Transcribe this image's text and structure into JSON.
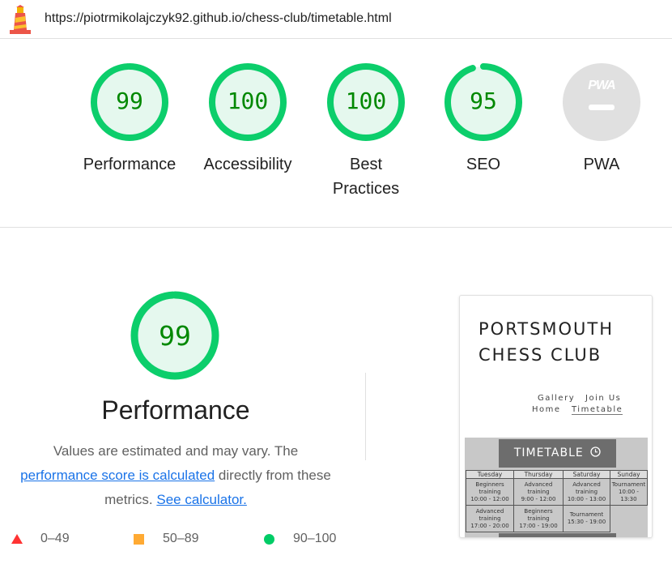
{
  "url": "https://piotrmikolajczyk92.github.io/chess-club/timetable.html",
  "colors": {
    "pass": "#0cce6b",
    "pass_text": "#008800",
    "average": "#ffaa33",
    "fail": "#ff3333",
    "link": "#1a73e8"
  },
  "gauges": [
    {
      "score": "99",
      "fraction": 0.99,
      "label_lines": [
        "Performance"
      ]
    },
    {
      "score": "100",
      "fraction": 1.0,
      "label_lines": [
        "Accessibility"
      ]
    },
    {
      "score": "100",
      "fraction": 1.0,
      "label_lines": [
        "Best",
        "Practices"
      ]
    },
    {
      "score": "95",
      "fraction": 0.95,
      "label_lines": [
        "SEO"
      ]
    }
  ],
  "pwa": {
    "badge_text": "PWA",
    "label": "PWA",
    "icon": "pwa-dash-icon"
  },
  "performance": {
    "score": "99",
    "fraction": 0.99,
    "title": "Performance",
    "desc_text_1": "Values are estimated and may vary. The",
    "desc_link_1": "performance score is calculated",
    "desc_text_2": "directly from these metrics.",
    "desc_link_2": "See calculator."
  },
  "legend": [
    {
      "icon": "triangle-icon",
      "range": "0–49"
    },
    {
      "icon": "square-icon",
      "range": "50–89"
    },
    {
      "icon": "circle-icon",
      "range": "90–100"
    }
  ],
  "thumbnail": {
    "club_line1": "PORTSMOUTH",
    "club_line2": "CHESS CLUB",
    "nav": {
      "gallery": "Gallery",
      "join": "Join Us",
      "home": "Home",
      "timetable": "Timetable"
    },
    "hero_button": "TIMETABLE",
    "hero_icon": "clock-icon",
    "timetable": {
      "headers": [
        "Tuesday",
        "Thursday",
        "Saturday",
        "Sunday"
      ],
      "row1": [
        [
          "Beginners",
          "training",
          "10:00 - 12:00"
        ],
        [
          "Advanced training",
          "9:00 - 12:00"
        ],
        [
          "Advanced",
          "training",
          "10:00 - 13:00"
        ],
        [
          "Tournament",
          "10:00 - 13:30"
        ]
      ],
      "row2": [
        [
          "Advanced training",
          "17:00 - 20:00"
        ],
        [
          "Beginners",
          "training",
          "17:00 - 19:00"
        ],
        [
          "Tournament",
          "15:30 - 19:00"
        ]
      ]
    }
  }
}
